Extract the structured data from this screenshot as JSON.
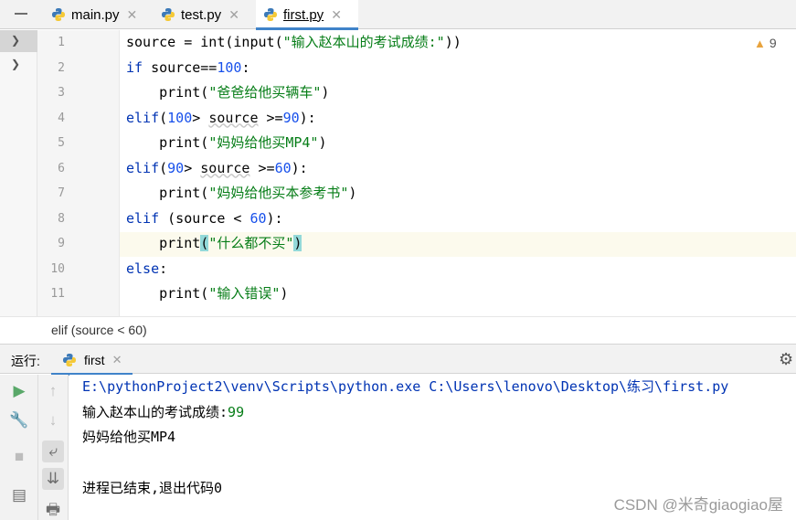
{
  "tabs": [
    {
      "label": "main.py",
      "active": false
    },
    {
      "label": "test.py",
      "active": false
    },
    {
      "label": "first.py",
      "active": true
    }
  ],
  "editor": {
    "line_numbers": [
      "1",
      "2",
      "3",
      "4",
      "5",
      "6",
      "7",
      "8",
      "9",
      "10",
      "11"
    ],
    "current_line": "9",
    "warning_count": "9",
    "lines": [
      [
        {
          "t": "source = ",
          "c": "fn"
        },
        {
          "t": "int",
          "c": "fn"
        },
        {
          "t": "(",
          "c": "fn"
        },
        {
          "t": "input",
          "c": "fn"
        },
        {
          "t": "(",
          "c": "fn"
        },
        {
          "t": "\"输入赵本山的考试成绩:\"",
          "c": "str"
        },
        {
          "t": "))",
          "c": "fn"
        }
      ],
      [
        {
          "t": "if",
          "c": "kw"
        },
        {
          "t": " source==",
          "c": "fn"
        },
        {
          "t": "100",
          "c": "num"
        },
        {
          "t": ":",
          "c": "fn"
        }
      ],
      [
        {
          "t": "    print",
          "c": "fn"
        },
        {
          "t": "(",
          "c": "fn"
        },
        {
          "t": "\"爸爸给他买辆车\"",
          "c": "str"
        },
        {
          "t": ")",
          "c": "fn"
        }
      ],
      [
        {
          "t": "elif",
          "c": "kw"
        },
        {
          "t": "(",
          "c": "fn"
        },
        {
          "t": "100",
          "c": "num"
        },
        {
          "t": "> ",
          "c": "fn"
        },
        {
          "t": "source",
          "c": "squiggle"
        },
        {
          "t": " >=",
          "c": "fn"
        },
        {
          "t": "90",
          "c": "num"
        },
        {
          "t": "):",
          "c": "fn"
        }
      ],
      [
        {
          "t": "    print",
          "c": "fn"
        },
        {
          "t": "(",
          "c": "fn"
        },
        {
          "t": "\"妈妈给他买MP4\"",
          "c": "str"
        },
        {
          "t": ")",
          "c": "fn"
        }
      ],
      [
        {
          "t": "elif",
          "c": "kw"
        },
        {
          "t": "(",
          "c": "fn"
        },
        {
          "t": "90",
          "c": "num"
        },
        {
          "t": "> ",
          "c": "fn"
        },
        {
          "t": "source",
          "c": "squiggle"
        },
        {
          "t": " >=",
          "c": "fn"
        },
        {
          "t": "60",
          "c": "num"
        },
        {
          "t": "):",
          "c": "fn"
        }
      ],
      [
        {
          "t": "    print",
          "c": "fn"
        },
        {
          "t": "(",
          "c": "fn"
        },
        {
          "t": "\"妈妈给他买本参考书\"",
          "c": "str"
        },
        {
          "t": ")",
          "c": "fn"
        }
      ],
      [
        {
          "t": "elif",
          "c": "kw"
        },
        {
          "t": " (source < ",
          "c": "fn"
        },
        {
          "t": "60",
          "c": "num"
        },
        {
          "t": "):",
          "c": "fn"
        }
      ],
      [
        {
          "t": "    print",
          "c": "fn"
        },
        {
          "t": "(",
          "c": "paren-hl"
        },
        {
          "t": "\"什么都不买\"",
          "c": "str"
        },
        {
          "t": ")",
          "c": "paren-hl"
        }
      ],
      [
        {
          "t": "else",
          "c": "kw"
        },
        {
          "t": ":",
          "c": "fn"
        }
      ],
      [
        {
          "t": "    print",
          "c": "fn"
        },
        {
          "t": "(",
          "c": "fn"
        },
        {
          "t": "\"输入错误\"",
          "c": "str"
        },
        {
          "t": ")",
          "c": "fn"
        }
      ]
    ]
  },
  "breadcrumb": "elif (source < 60)",
  "run": {
    "label": "运行:",
    "tab_label": "first",
    "console": {
      "command": "E:\\pythonProject2\\venv\\Scripts\\python.exe C:\\Users\\lenovo\\Desktop\\练习\\first.py",
      "prompt": "输入赵本山的考试成绩:",
      "input_value": "99",
      "output": "妈妈给他买MP4",
      "exit_message": "进程已结束,退出代码0"
    }
  },
  "watermark": "CSDN @米奇giaogiao屋",
  "colors": {
    "keyword": "#0033b3",
    "number": "#1750eb",
    "string": "#067d17",
    "accent": "#4083c9"
  }
}
